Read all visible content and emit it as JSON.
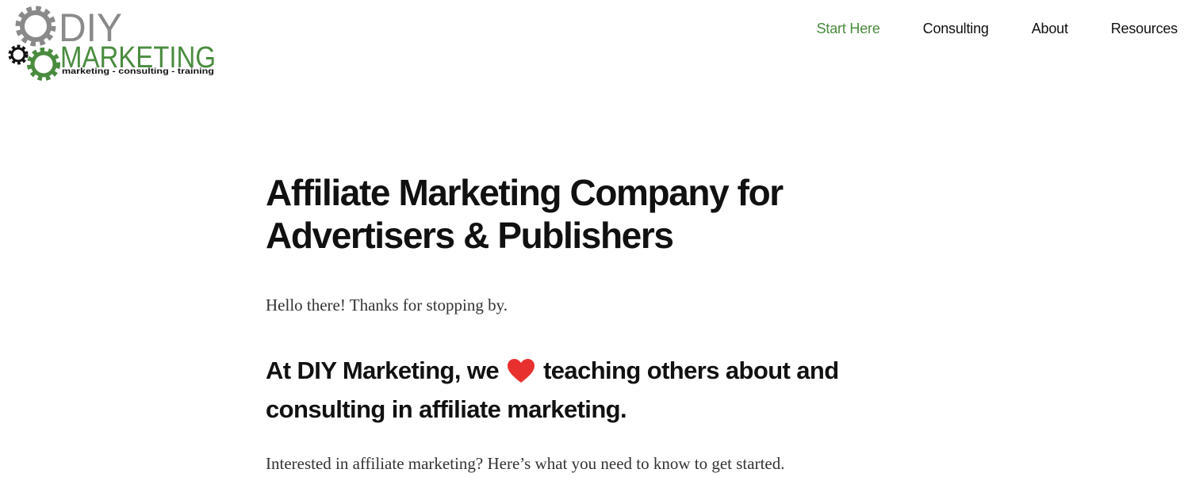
{
  "header": {
    "logo": {
      "brand_top": "DIY",
      "brand_main": "MARKETING",
      "tagline": "marketing - consulting - training"
    },
    "nav": [
      {
        "label": "Start Here",
        "active": true
      },
      {
        "label": "Consulting",
        "active": false
      },
      {
        "label": "About",
        "active": false
      },
      {
        "label": "Resources",
        "active": false
      }
    ]
  },
  "main": {
    "title": "Affiliate Marketing Company for Advertisers & Publishers",
    "intro": "Hello there! Thanks for stopping by.",
    "subheading": {
      "before": "At DIY Marketing, we",
      "icon": "heart-icon",
      "after": "teaching others about and consulting in affiliate marketing."
    },
    "body": "Interested in affiliate marketing? Here’s what you need to know to get started."
  },
  "colors": {
    "accent_green": "#4a8c3f",
    "gear_gray": "#8a8a8a",
    "heart_red": "#e8312f",
    "text_dark": "#111111"
  }
}
